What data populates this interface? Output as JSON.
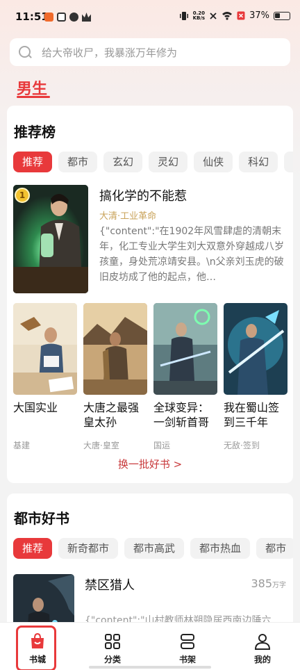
{
  "status_bar": {
    "time": "11:51",
    "net_speed_value": "0.20",
    "net_speed_unit": "KB/s",
    "battery": "37%"
  },
  "search": {
    "placeholder": "给大帝收尸，我暴涨万年修为"
  },
  "gender_tab": "男生",
  "ranking": {
    "title": "推荐榜",
    "tabs": [
      "推荐",
      "都市",
      "玄幻",
      "灵幻",
      "仙侠",
      "科幻"
    ],
    "top_book": {
      "rank": "1",
      "title": "搞化学的不能惹",
      "tags": "大清·工业革命",
      "desc": "{\"content\":\"在1902年风雪肆虐的清朝末年，化工专业大学生刘大双意外穿越成八岁孩童，身处荒凉靖安县。\\n父亲刘玉虎的破旧皮坊成了他的起点，他…"
    },
    "books": [
      {
        "title": "大国实业",
        "tags": "基建"
      },
      {
        "title": "大唐之最强皇太孙",
        "tags": "大唐·皇室"
      },
      {
        "title": "全球变异：一剑斩首哥",
        "tags": "国运"
      },
      {
        "title": "我在蜀山签到三千年",
        "tags": "无敌·签到"
      }
    ],
    "refresh": "换一批好书 >"
  },
  "city": {
    "title": "都市好书",
    "tabs": [
      "推荐",
      "新奇都市",
      "都市高武",
      "都市热血",
      "都市"
    ],
    "book": {
      "title": "禁区猎人",
      "words_value": "385",
      "words_unit": "万字",
      "desc": "{\"content\":\"山村教师林朔隐居西南边陲六"
    }
  },
  "nav": [
    {
      "label": "书城",
      "icon": "bookstore-icon"
    },
    {
      "label": "分类",
      "icon": "category-icon"
    },
    {
      "label": "书架",
      "icon": "bookshelf-icon"
    },
    {
      "label": "我的",
      "icon": "profile-icon"
    }
  ],
  "colors": {
    "accent": "#e8393b",
    "tag_gold": "#c9a35a"
  }
}
